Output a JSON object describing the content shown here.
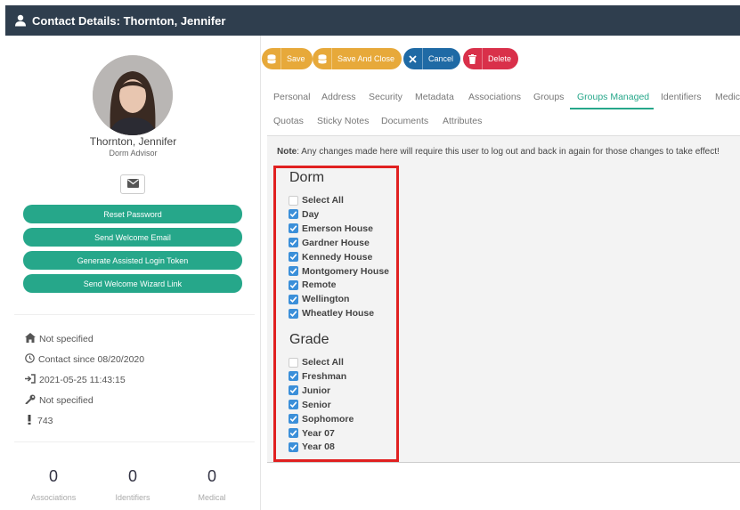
{
  "window": {
    "title": "Contact Details: Thornton, Jennifer"
  },
  "contact": {
    "name": "Thornton, Jennifer",
    "role": "Dorm Advisor",
    "actions": [
      "Reset Password",
      "Send Welcome Email",
      "Generate Assisted Login Token",
      "Send Welcome Wizard Link"
    ]
  },
  "info": {
    "home": "Not specified",
    "contact_since": "Contact since 08/20/2020",
    "last_login": "2021-05-25 11:43:15",
    "key": "Not specified",
    "id": "743"
  },
  "stats": [
    {
      "value": "0",
      "label": "Associations"
    },
    {
      "value": "0",
      "label": "Identifiers"
    },
    {
      "value": "0",
      "label": "Medical"
    }
  ],
  "toolbar": {
    "save": "Save",
    "save_close": "Save And Close",
    "cancel": "Cancel",
    "delete": "Delete"
  },
  "tabs_row1": [
    "Personal",
    "Address",
    "Security",
    "Metadata",
    "Associations",
    "Groups",
    "Groups Managed",
    "Identifiers",
    "Medic"
  ],
  "tabs_row2": [
    "Quotas",
    "Sticky Notes",
    "Documents",
    "Attributes"
  ],
  "active_tab": "Groups Managed",
  "note": {
    "label": "Note",
    "text": ": Any changes made here will require this user to log out and back in again for those changes to take effect!"
  },
  "groups": {
    "dorm": {
      "title": "Dorm",
      "items": [
        {
          "label": "Select All",
          "checked": false
        },
        {
          "label": "Day",
          "checked": true
        },
        {
          "label": "Emerson House",
          "checked": true
        },
        {
          "label": "Gardner House",
          "checked": true
        },
        {
          "label": "Kennedy House",
          "checked": true
        },
        {
          "label": "Montgomery House",
          "checked": true
        },
        {
          "label": "Remote",
          "checked": true
        },
        {
          "label": "Wellington",
          "checked": true
        },
        {
          "label": "Wheatley House",
          "checked": true
        }
      ]
    },
    "grade": {
      "title": "Grade",
      "items": [
        {
          "label": "Select All",
          "checked": false
        },
        {
          "label": "Freshman",
          "checked": true
        },
        {
          "label": "Junior",
          "checked": true
        },
        {
          "label": "Senior",
          "checked": true
        },
        {
          "label": "Sophomore",
          "checked": true
        },
        {
          "label": "Year 07",
          "checked": true
        },
        {
          "label": "Year 08",
          "checked": true
        }
      ]
    }
  },
  "colors": {
    "titlebar": "#2f3e4e",
    "accent": "#26a78a",
    "save": "#e7a93a",
    "cancel": "#1f6aa5",
    "delete": "#d9304a",
    "checkbox": "#3b8fd9",
    "highlight": "#e02020"
  }
}
